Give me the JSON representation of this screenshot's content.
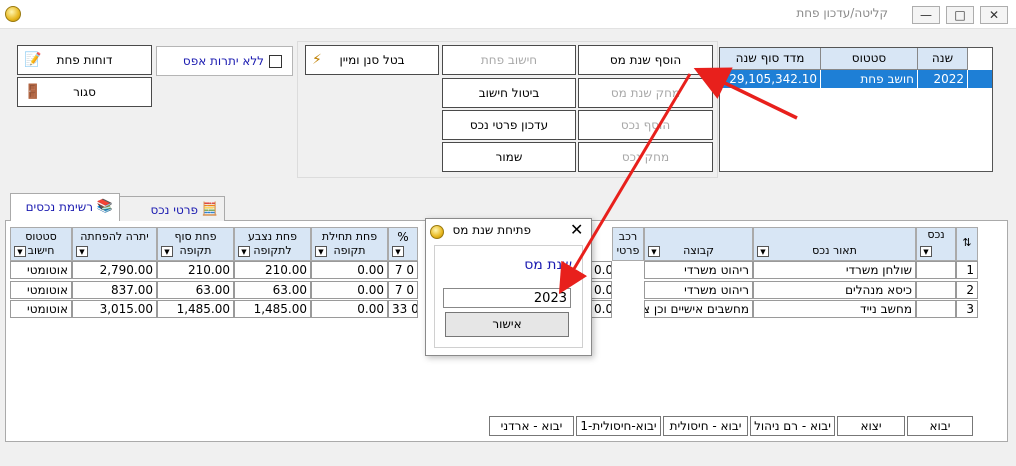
{
  "window": {
    "title": "קליטה/עדכון פחת",
    "controls": {
      "minimize": "—",
      "maximize": "□",
      "close": "✕"
    }
  },
  "toolbar": {
    "depreciation_reports": "דוחות פחת",
    "close": "סגור",
    "no_zero_balance": "ללא יתרות אפס",
    "cancel_filter_sort": "בטל סנן ומיין",
    "calc_depreciation": "חישוב פחת",
    "add_tax_year": "הוסף שנת מס",
    "cancel_calculation": "ביטול חישוב",
    "delete_tax_year": "מחק שנת מס",
    "update_asset_details": "עדכון פרטי נכס",
    "add_asset": "הוסף נכס",
    "save": "שמור",
    "delete_asset": "מחק נכס"
  },
  "years_grid": {
    "headers": {
      "year": "שנה",
      "status": "סטטוס",
      "index": "מדד סוף שנה"
    },
    "rows": [
      {
        "year": "2022",
        "status": "חושב פחת",
        "index": "29,105,342.10"
      }
    ]
  },
  "tabs": {
    "asset_list": "רשימת נכסים",
    "asset_details": "פרטי נכס"
  },
  "assets_table": {
    "headers": {
      "asset": "נכס",
      "description": "תאור נכס",
      "group": "קבוצה",
      "component": "רכב פרטי",
      "percent": "%",
      "opening_dep": "פחת תחילת תקופה",
      "accrued_dep": "פחת נצבע לתקופה",
      "closing_dep": "פחת סוף תקופה",
      "balance": "יתרה להפחתה",
      "calc_status": "סטטוס חישוב"
    },
    "rows": [
      {
        "no": "1",
        "description": "שולחן משרדי",
        "group": "ריהוט משרדי",
        "component": "0.00",
        "percent": "7",
        "pct_part": "0",
        "opening": "0.00",
        "accrued": "210.00",
        "closing": "210.00",
        "balance": "2,790.00",
        "status": "אוטומטי"
      },
      {
        "no": "2",
        "description": "כיסא מנהלים",
        "group": "ריהוט משרדי",
        "component": "0.00",
        "percent": "7",
        "pct_part": "0",
        "opening": "0.00",
        "accrued": "63.00",
        "closing": "63.00",
        "balance": "837.00",
        "status": "אוטומטי"
      },
      {
        "no": "3",
        "description": "מחשב נייד",
        "group": "מחשבים אישיים וכן ציוד",
        "component": "0.00",
        "percent": "33",
        "pct_part": "0",
        "opening": "0.00",
        "accrued": "1,485.00",
        "closing": "1,485.00",
        "balance": "3,015.00",
        "status": "אוטומטי"
      }
    ]
  },
  "import_buttons": [
    "יבוא",
    "יצוא",
    "יבוא - רם ניהול",
    "יבוא - חיסולית",
    "יבוא-חיסולית-1",
    "יבוא - ארדני"
  ],
  "dialog": {
    "title": "פתיחת שנת מס",
    "year_label": "שנת מס",
    "year_value": "2023",
    "ok": "אישור",
    "close": "✕"
  },
  "colors": {
    "selection": "#1e7fd6",
    "header": "#d8e6f5",
    "link_text": "#1a1ab0",
    "arrow": "#e8201c"
  },
  "icons": [
    "report-icon",
    "exit-icon",
    "filter-icon",
    "books-icon",
    "calculator-icon",
    "coin-icon"
  ]
}
